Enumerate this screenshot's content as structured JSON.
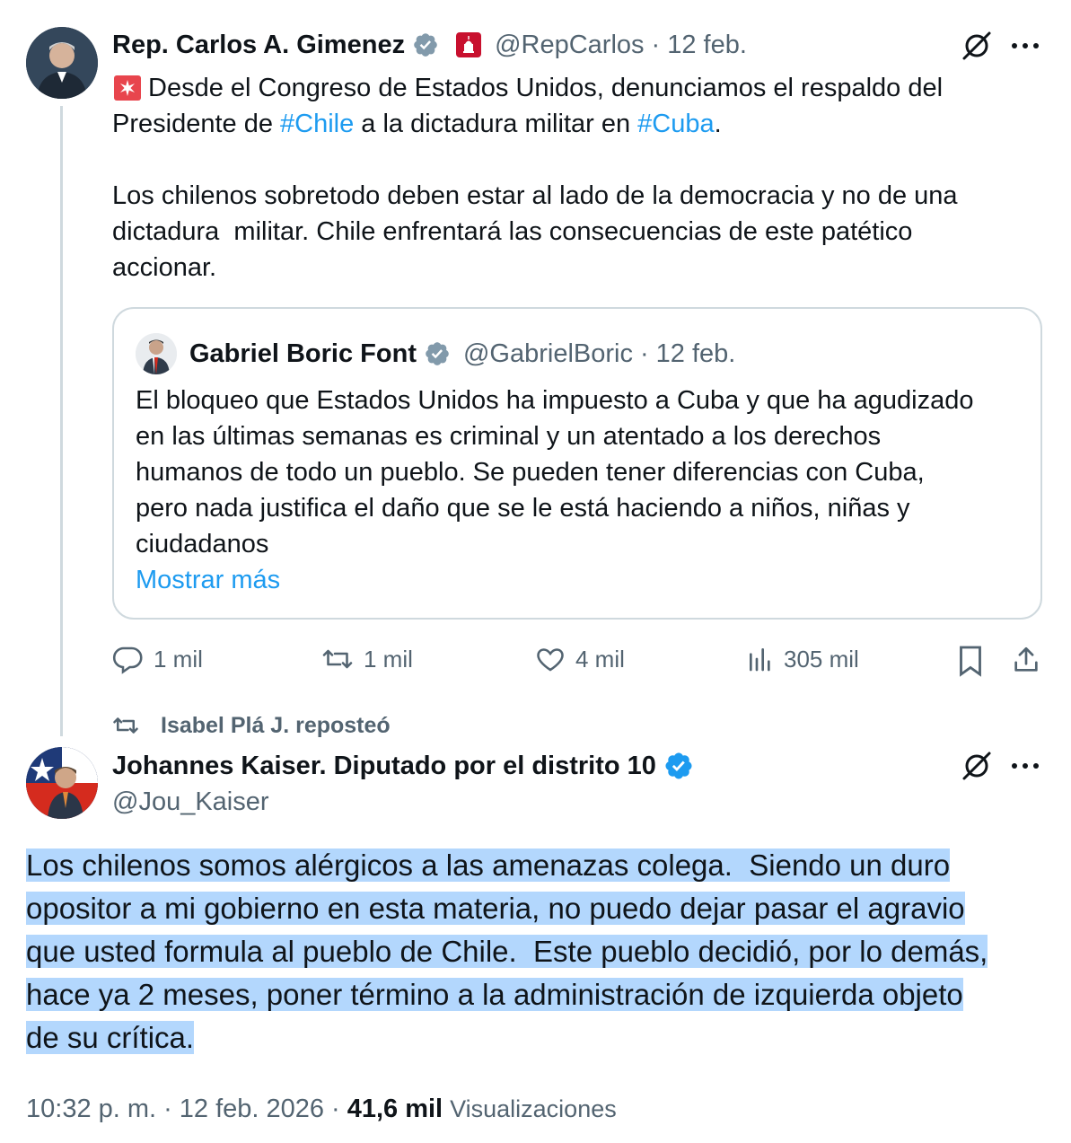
{
  "parent_tweet": {
    "author_name": "Rep. Carlos A. Gimenez",
    "handle": "@RepCarlos",
    "separator": "·",
    "date": "12 feb.",
    "emoji": "🚨",
    "line1a": "Desde el Congreso de Estados Unidos, denunciamos el respaldo del",
    "line2a": "Presidente de ",
    "hashtag1": "#Chile",
    "line2b": " a la dictadura militar en ",
    "hashtag2": "#Cuba",
    "line2c": ".",
    "line3": "Los chilenos sobretodo deben estar al lado de la democracia y no de una",
    "line4": "dictadura  militar. Chile enfrentará las consecuencias de este patético",
    "line5": "accionar.",
    "actions": {
      "replies": "1 mil",
      "reposts": "1 mil",
      "likes": "4 mil",
      "views": "305 mil"
    }
  },
  "quoted_tweet": {
    "author_name": "Gabriel Boric Font",
    "handle": "@GabrielBoric",
    "separator": "·",
    "date": "12 feb.",
    "lines": [
      "El bloqueo que Estados Unidos ha impuesto a Cuba y que ha agudizado",
      "en las últimas semanas es criminal y un atentado a los derechos",
      "humanos de todo un pueblo. Se pueden tener diferencias con Cuba,",
      "pero nada justifica el daño que se le está haciendo a niños, niñas y",
      "ciudadanos"
    ],
    "show_more": "Mostrar más"
  },
  "repost_context": "Isabel Plá J. reposteó",
  "main_tweet": {
    "author_name": "Johannes Kaiser. Diputado por el distrito 10",
    "handle": "@Jou_Kaiser",
    "lines": [
      "Los chilenos somos alérgicos a las amenazas colega.  Siendo un duro",
      "opositor a mi gobierno en esta materia, no puedo dejar pasar el agravio",
      "que usted formula al pueblo de Chile.  Este pueblo decidió, por lo demás,",
      "hace ya 2 meses, poner término a la administración de izquierda objeto",
      "de su crítica."
    ],
    "time": "10:32 p. m.",
    "separator": "·",
    "date": "12 feb. 2026",
    "views_count": "41,6 mil",
    "views_label": "Visualizaciones"
  },
  "colors": {
    "verified_gray": "#829aab",
    "verified_blue": "#1d9bf0",
    "link": "#1d9bf0",
    "secondary_text": "#536471",
    "selection": "#b3d7fd"
  },
  "icons": [
    "verified-badge-icon",
    "capitol-badge-icon",
    "grok-icon",
    "more-icon",
    "reply-icon",
    "repost-icon",
    "like-icon",
    "views-icon",
    "bookmark-icon",
    "share-icon"
  ]
}
